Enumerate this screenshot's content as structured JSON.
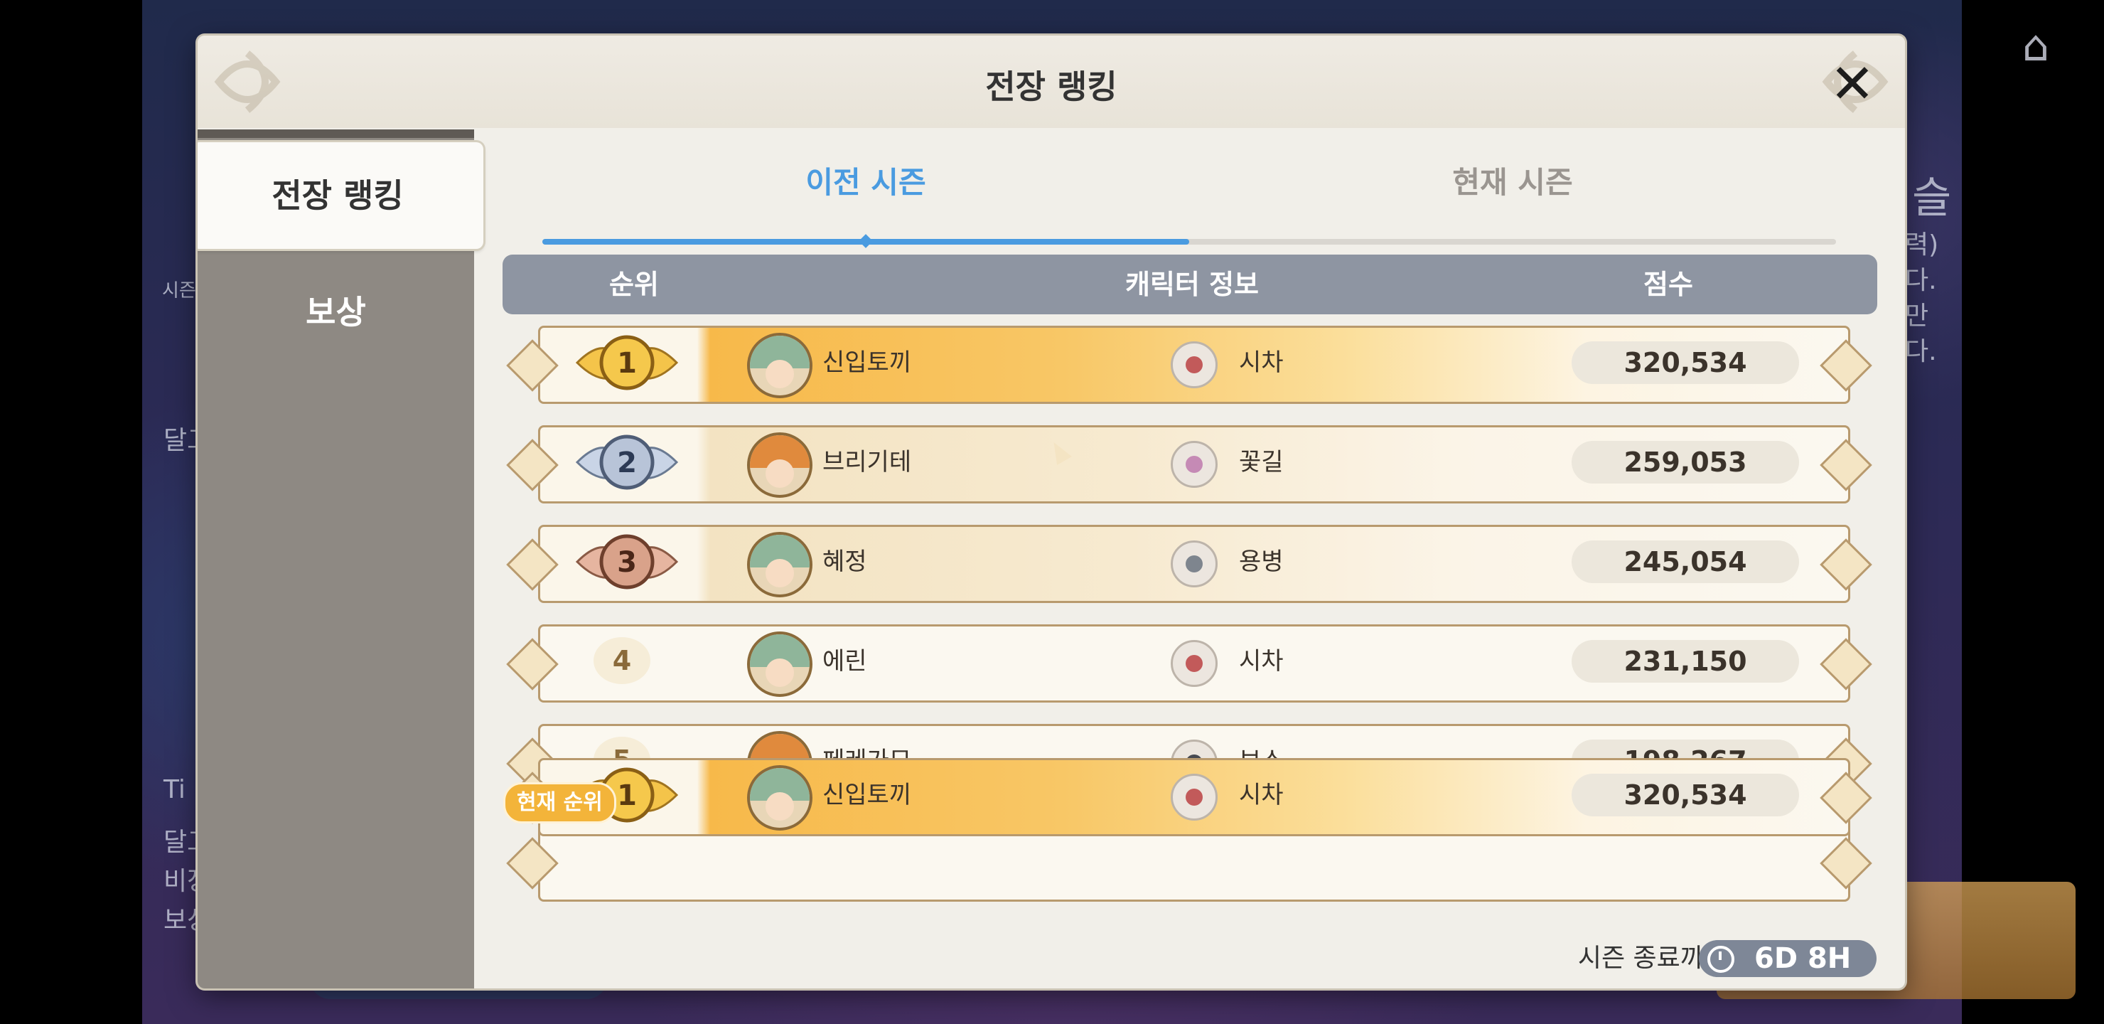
{
  "background": {
    "left_text_1": "달그",
    "left_text_2": "Ti",
    "left_text_3": "달그",
    "left_text_4": "비장",
    "left_text_5": "보상",
    "left_text_6": "시즌",
    "right_text_1": "슬",
    "right_text_2": "력)",
    "right_text_3": "다.",
    "right_text_4": "만",
    "right_text_5": "다."
  },
  "modal": {
    "title": "전장 랭킹",
    "close_icon": "close-icon"
  },
  "sidebar": {
    "items": [
      {
        "label": "전장 랭킹",
        "active": true
      },
      {
        "label": "보상",
        "active": false
      }
    ]
  },
  "season_tabs": [
    {
      "label": "이전 시즌",
      "active": true
    },
    {
      "label": "현재 시즌",
      "active": false
    }
  ],
  "table": {
    "headers": {
      "rank": "순위",
      "character": "캐릭터 정보",
      "score": "점수"
    },
    "rows": [
      {
        "rank": "1",
        "name": "신입토끼",
        "class": "시차",
        "score": "320,534"
      },
      {
        "rank": "2",
        "name": "브리기테",
        "class": "꽃길",
        "score": "259,053"
      },
      {
        "rank": "3",
        "name": "혜정",
        "class": "용병",
        "score": "245,054"
      },
      {
        "rank": "4",
        "name": "에린",
        "class": "시차",
        "score": "231,150"
      },
      {
        "rank": "5",
        "name": "페레가모",
        "class": "보스",
        "score": "198,267"
      }
    ]
  },
  "current": {
    "badge": "현재 순위",
    "rank": "1",
    "name": "신입토끼",
    "class": "시차",
    "score": "320,534"
  },
  "footer": {
    "label": "시즌 종료까지",
    "timer": "6D 8H",
    "timer_icon": "clock-icon"
  },
  "colors": {
    "accent_blue": "#4a9be0",
    "gold": "#f7b94a",
    "header_gray": "#8e95a2"
  }
}
